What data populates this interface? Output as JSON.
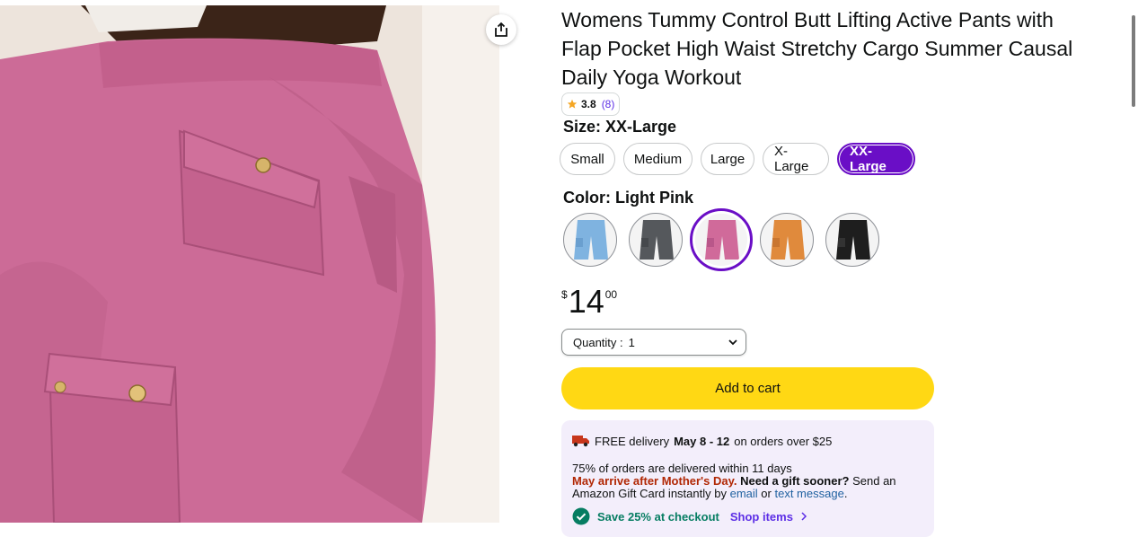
{
  "product": {
    "title": "Womens Tummy Control Butt Lifting Active Pants with Flap Pocket High Waist Stretchy Cargo Summer Causal Daily Yoga Workout",
    "rating": {
      "score": "3.8",
      "count": "(8)"
    },
    "image_icon": "product-photo-pink-cargo-leggings"
  },
  "size": {
    "label": "Size:",
    "selected": "XX-Large",
    "options": [
      "Small",
      "Medium",
      "Large",
      "X-Large",
      "XX-Large"
    ]
  },
  "color": {
    "label": "Color:",
    "selected": "Light Pink",
    "swatches": [
      {
        "name": "light-blue",
        "hex": "#7fb3e0"
      },
      {
        "name": "dark-gray",
        "hex": "#55585c"
      },
      {
        "name": "light-pink",
        "hex": "#d06a9a"
      },
      {
        "name": "orange",
        "hex": "#e08a3c"
      },
      {
        "name": "black",
        "hex": "#1e1e1e"
      }
    ]
  },
  "price": {
    "symbol": "$",
    "whole": "14",
    "fraction": "00"
  },
  "quantity": {
    "label": "Quantity :",
    "value": "1"
  },
  "add_to_cart": "Add to cart",
  "delivery": {
    "free_text": "FREE delivery",
    "dates": "May 8 - 12",
    "threshold": "on orders over $25",
    "stat": "75% of orders are delivered within 11 days",
    "warning": "May arrive after Mother's Day.",
    "gift_q": "Need a gift sooner?",
    "gift_text_1": "Send an Amazon Gift Card instantly by",
    "email_link": "email",
    "or": "or",
    "text_link": "text message",
    "period": ".",
    "save_text": "Save 25% at checkout",
    "shop_text": "Shop items"
  },
  "colors": {
    "accent": "#6a0ec6",
    "cart": "#ffd814",
    "link": "#2162a1",
    "warn": "#b12704",
    "save": "#067d62"
  }
}
